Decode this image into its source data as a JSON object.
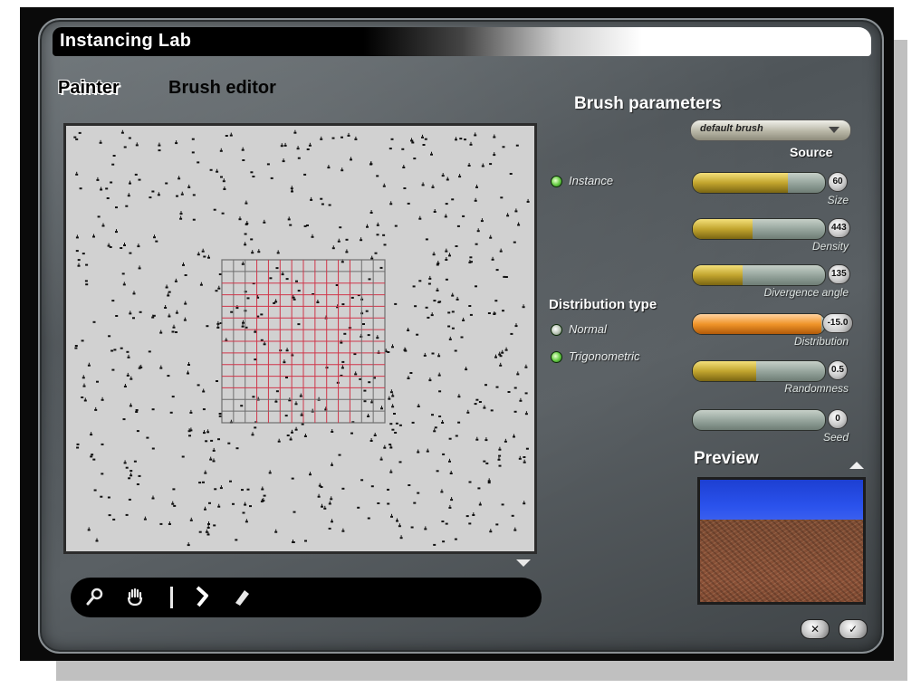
{
  "window": {
    "title": "Instancing Lab"
  },
  "tabs": {
    "painter": "Painter",
    "brush_editor": "Brush editor"
  },
  "brush_parameters": {
    "heading": "Brush parameters",
    "brush_select": "default brush",
    "source_label": "Source",
    "instance_option": "Instance",
    "distribution_heading": "Distribution type",
    "distribution_options": [
      "Normal",
      "Trigonometric"
    ],
    "sliders": [
      {
        "label": "Size",
        "value": "60",
        "fill": 0.72,
        "color": "gold"
      },
      {
        "label": "Density",
        "value": "443",
        "fill": 0.45,
        "color": "gold"
      },
      {
        "label": "Divergence angle",
        "value": "135",
        "fill": 0.38,
        "color": "gold"
      },
      {
        "label": "Distribution",
        "value": "-15.0",
        "fill": 0.97,
        "color": "orange"
      },
      {
        "label": "Randomness",
        "value": "0.5",
        "fill": 0.48,
        "color": "gold"
      },
      {
        "label": "Seed",
        "value": "0",
        "fill": 0.0,
        "color": "gold"
      }
    ]
  },
  "preview": {
    "heading": "Preview"
  },
  "toolbar": {
    "icons": [
      "zoom-icon",
      "pan-hand-icon",
      "divider",
      "brush-stroke-icon",
      "eraser-icon"
    ]
  },
  "colors": {
    "canvas_bg": "#d1d1d1",
    "grid_red": "#d0364a",
    "grid_gray": "#6e6e6e",
    "point": "#111111"
  }
}
